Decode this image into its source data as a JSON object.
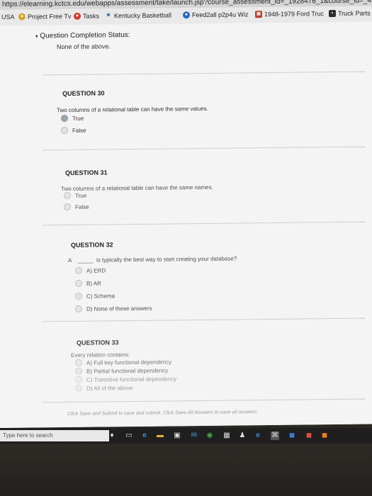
{
  "browser": {
    "url": "https://elearning.kctcs.edu/webapps/assessment/take/launch.jsp?course_assessment_id=_1928476_1&course_id=_493",
    "bookmarks": [
      {
        "label": "USA"
      },
      {
        "label": "Project Free Tv"
      },
      {
        "label": "Tasks"
      },
      {
        "label": "Kentucky Basketball"
      },
      {
        "label": "Feed2all p2p4u Wiz"
      },
      {
        "label": "1948-1979 Ford Truc"
      },
      {
        "label": "Truck Parts a"
      }
    ]
  },
  "page": {
    "status_header": "Question Completion Status:",
    "none_above_top": "None of the above.",
    "questions": [
      {
        "title": "QUESTION 30",
        "text": "Two columns of a relational table can have the same values.",
        "options": [
          "True",
          "False"
        ]
      },
      {
        "title": "QUESTION 31",
        "text": "Two columns of a relational table can have the same names.",
        "options": [
          "True",
          "False"
        ]
      },
      {
        "title": "QUESTION 32",
        "prefix": "A",
        "text": "is typically the best way to start creating your database?",
        "options": [
          "A) ERD",
          "B) AR",
          "C) Schema",
          "D) None of these answers"
        ]
      },
      {
        "title": "QUESTION 33",
        "text": "Every relation contains:",
        "options": [
          "A) Full key functional dependency",
          "B) Partial functional dependency",
          "C) Transitive functional dependency",
          "D) All of the above"
        ]
      }
    ],
    "footer_note": "Click Save and Submit to save and submit. Click Save All Answers to save all answers."
  },
  "taskbar": {
    "search_placeholder": "Type here to search"
  }
}
